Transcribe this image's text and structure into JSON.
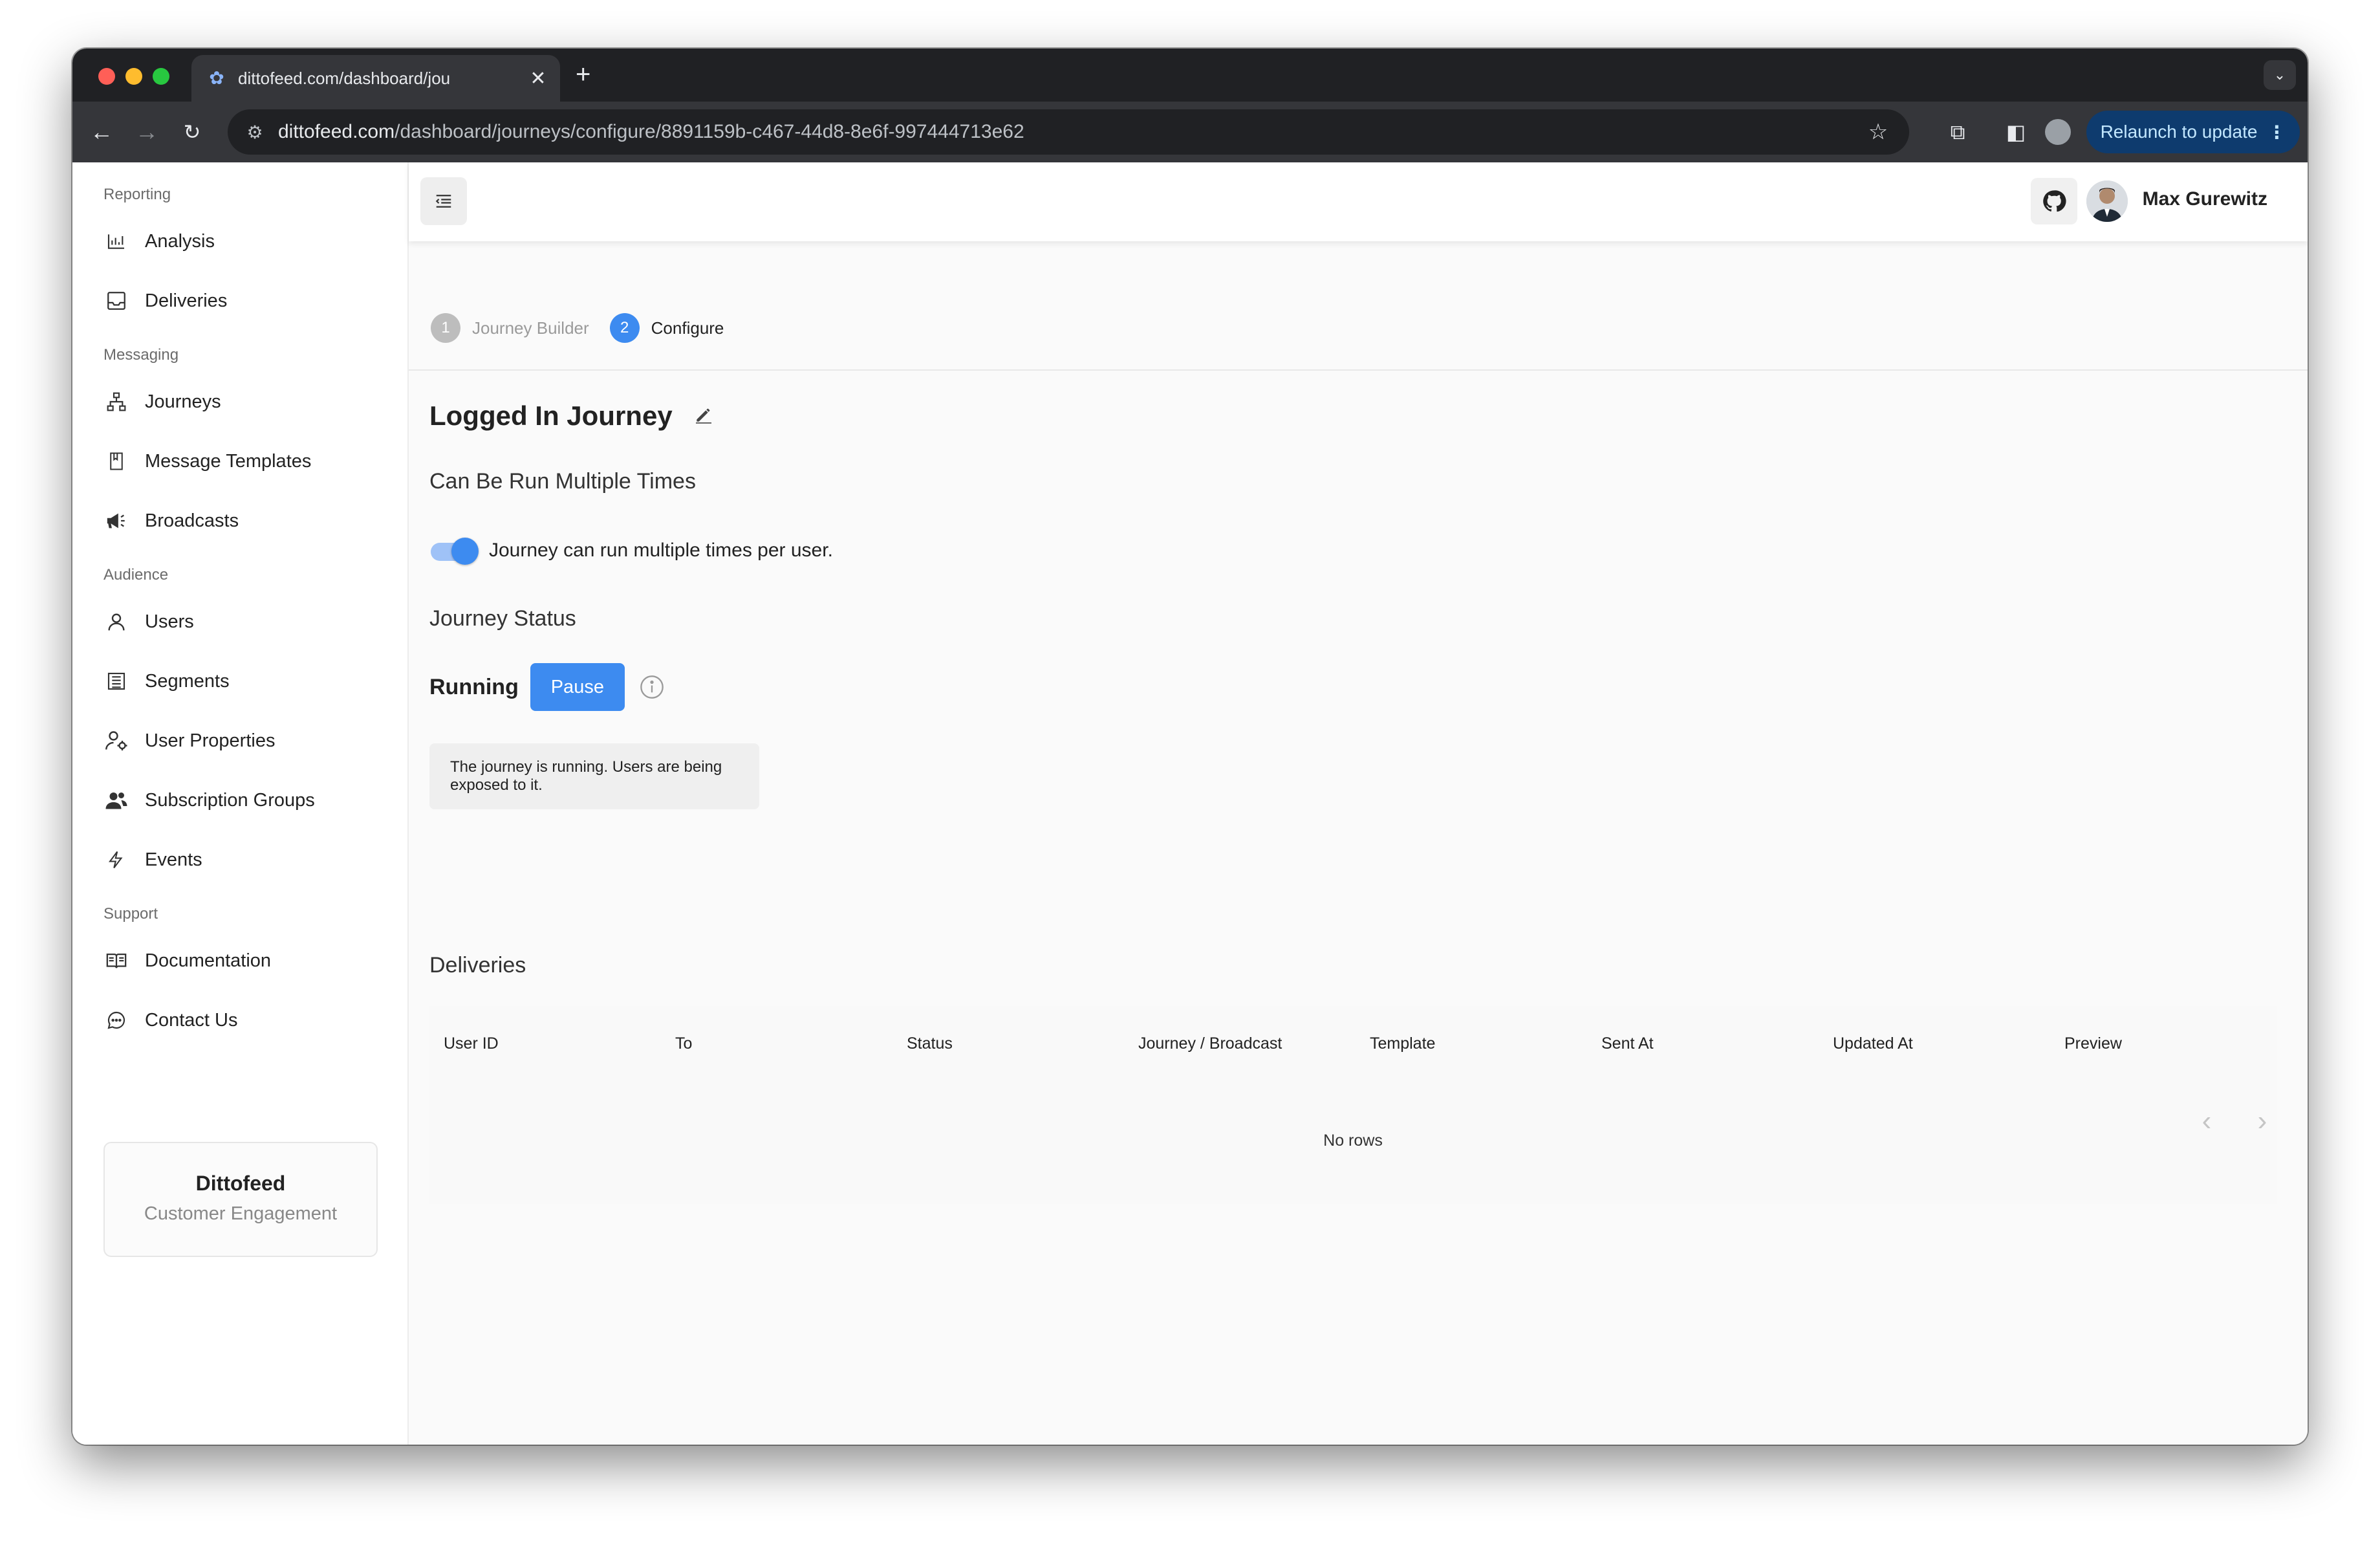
{
  "browser": {
    "tab_title": "dittofeed.com/dashboard/jou",
    "url_host": "dittofeed.com",
    "url_path": "/dashboard/journeys/configure/8891159b-c467-44d8-8e6f-997444713e62",
    "relaunch_label": "Relaunch to update"
  },
  "sidebar": {
    "sections": [
      {
        "label": "Reporting",
        "items": [
          {
            "label": "Analysis",
            "icon": "chart-icon"
          },
          {
            "label": "Deliveries",
            "icon": "inbox-icon"
          }
        ]
      },
      {
        "label": "Messaging",
        "items": [
          {
            "label": "Journeys",
            "icon": "sitemap-icon"
          },
          {
            "label": "Message Templates",
            "icon": "document-icon"
          },
          {
            "label": "Broadcasts",
            "icon": "megaphone-icon"
          }
        ]
      },
      {
        "label": "Audience",
        "items": [
          {
            "label": "Users",
            "icon": "user-icon"
          },
          {
            "label": "Segments",
            "icon": "segments-icon"
          },
          {
            "label": "User Properties",
            "icon": "user-settings-icon"
          },
          {
            "label": "Subscription Groups",
            "icon": "group-icon"
          },
          {
            "label": "Events",
            "icon": "bolt-icon"
          }
        ]
      },
      {
        "label": "Support",
        "items": [
          {
            "label": "Documentation",
            "icon": "book-icon"
          },
          {
            "label": "Contact Us",
            "icon": "chat-icon"
          }
        ]
      }
    ],
    "brand": {
      "name": "Dittofeed",
      "tagline": "Customer Engagement"
    }
  },
  "header": {
    "user_name": "Max Gurewitz"
  },
  "stepper": {
    "steps": [
      {
        "number": "1",
        "label": "Journey Builder",
        "active": false
      },
      {
        "number": "2",
        "label": "Configure",
        "active": true
      }
    ]
  },
  "journey": {
    "title": "Logged In Journey",
    "multi_heading": "Can Be Run Multiple Times",
    "multi_toggle_label": "Journey can run multiple times per user.",
    "multi_toggle_on": true,
    "status_heading": "Journey Status",
    "status_value": "Running",
    "pause_label": "Pause",
    "status_message": "The journey is running. Users are being exposed to it."
  },
  "deliveries": {
    "heading": "Deliveries",
    "columns": [
      "User ID",
      "To",
      "Status",
      "Journey / Broadcast",
      "Template",
      "Sent At",
      "Updated At",
      "Preview"
    ],
    "empty_text": "No rows"
  },
  "colors": {
    "accent": "#3d8bf0",
    "toolbar": "#35363a",
    "tabstrip": "#202124"
  }
}
